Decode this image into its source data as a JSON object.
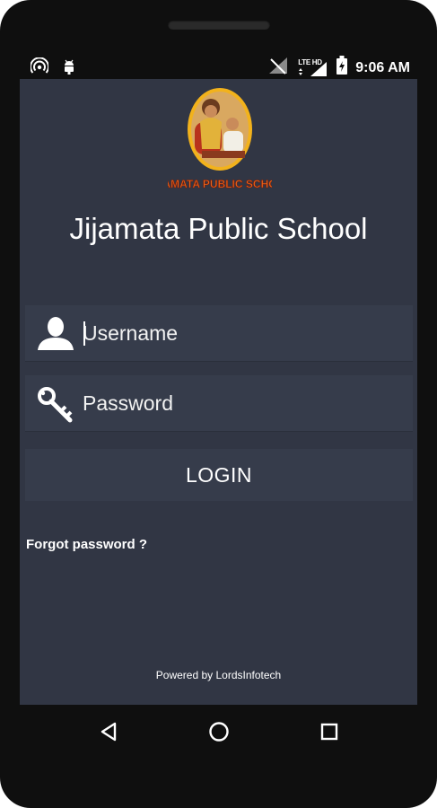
{
  "app": {
    "logo_text": "JIJAMATA PUBLIC SCHOOL",
    "title": "Jijamata Public School"
  },
  "statusbar": {
    "time": "9:06 AM",
    "network_label": "LTE HD",
    "icons": [
      "hotspot-icon",
      "android-debug-icon",
      "no-signal-icon",
      "lte-signal-icon",
      "battery-charging-icon"
    ]
  },
  "form": {
    "username": {
      "placeholder": "Username",
      "value": "",
      "icon": "user-icon"
    },
    "password": {
      "placeholder": "Password",
      "value": "",
      "icon": "key-icon"
    },
    "login_label": "LOGIN",
    "forgot_label": "Forgot password ?"
  },
  "footer": {
    "powered_by": "Powered by LordsInfotech"
  },
  "navbar": {
    "icons": [
      "back-icon",
      "home-icon",
      "recents-icon"
    ]
  },
  "colors": {
    "background": "#313644",
    "field": "#363c4b",
    "text": "#ffffff",
    "logo_text": "#e8651a",
    "logo_border": "#f2b21c"
  }
}
